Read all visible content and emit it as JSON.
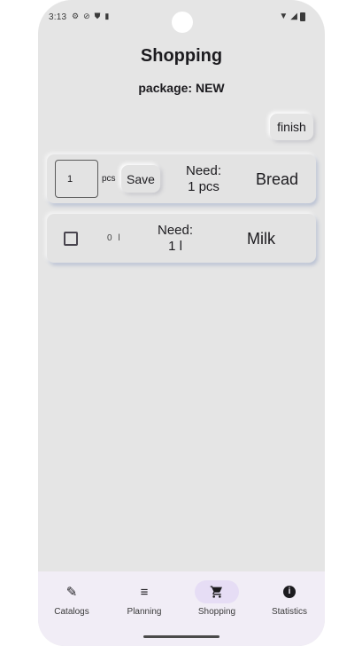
{
  "status_bar": {
    "time": "3:13",
    "left_icons": [
      "settings-icon",
      "do-not-disturb-icon",
      "shield-icon",
      "sd-card-icon"
    ],
    "right_icons": [
      "wifi-icon",
      "signal-icon",
      "battery-icon"
    ]
  },
  "page": {
    "title": "Shopping",
    "package_label": "package: NEW"
  },
  "actions": {
    "finish_label": "finish"
  },
  "items": [
    {
      "mode": "edit",
      "quantity_value": "1",
      "unit": "pcs",
      "save_label": "Save",
      "need_label": "Need:",
      "need_amount": "1 pcs",
      "name": "Bread"
    },
    {
      "mode": "check",
      "checked": false,
      "quantity": "0 l",
      "need_label": "Need:",
      "need_amount": "1 l",
      "name": "Milk"
    }
  ],
  "nav": [
    {
      "label": "Catalogs",
      "icon": "pencil-icon",
      "active": false
    },
    {
      "label": "Planning",
      "icon": "list-icon",
      "active": false
    },
    {
      "label": "Shopping",
      "icon": "cart-icon",
      "active": true
    },
    {
      "label": "Statistics",
      "icon": "info-icon",
      "active": false
    }
  ],
  "colors": {
    "background": "#e5e5e5",
    "nav_background": "#f1edf6",
    "active_pill": "#e6ddf5"
  }
}
